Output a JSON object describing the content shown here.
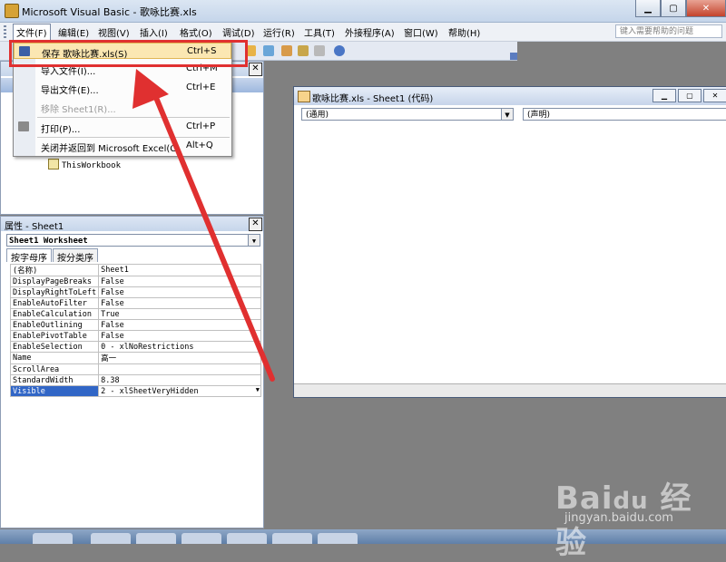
{
  "window": {
    "title": "Microsoft Visual Basic - 歌咏比赛.xls"
  },
  "menubar": {
    "items": [
      "文件(F)",
      "编辑(E)",
      "视图(V)",
      "插入(I)",
      "格式(O)",
      "调试(D)",
      "运行(R)",
      "工具(T)",
      "外接程序(A)",
      "窗口(W)",
      "帮助(H)"
    ],
    "help_placeholder": "键入需要帮助的问题"
  },
  "file_menu": {
    "items": [
      {
        "label": "保存 歌咏比赛.xls(S)",
        "shortcut": "Ctrl+S"
      },
      {
        "label": "导入文件(I)...",
        "shortcut": "Ctrl+M"
      },
      {
        "label": "导出文件(E)...",
        "shortcut": "Ctrl+E"
      },
      {
        "label": "移除 Sheet1(R)...",
        "shortcut": ""
      },
      {
        "label": "打印(P)...",
        "shortcut": "Ctrl+P"
      },
      {
        "label": "关闭并返回到 Microsoft Excel(C)",
        "shortcut": "Alt+Q"
      }
    ]
  },
  "project": {
    "node": "ThisWorkbook"
  },
  "properties": {
    "title": "属性 - Sheet1",
    "object": "Sheet1 Worksheet",
    "tabs": [
      "按字母序",
      "按分类序"
    ],
    "rows": [
      {
        "k": "(名称)",
        "v": "Sheet1"
      },
      {
        "k": "DisplayPageBreaks",
        "v": "False"
      },
      {
        "k": "DisplayRightToLeft",
        "v": "False"
      },
      {
        "k": "EnableAutoFilter",
        "v": "False"
      },
      {
        "k": "EnableCalculation",
        "v": "True"
      },
      {
        "k": "EnableOutlining",
        "v": "False"
      },
      {
        "k": "EnablePivotTable",
        "v": "False"
      },
      {
        "k": "EnableSelection",
        "v": "0 - xlNoRestrictions"
      },
      {
        "k": "Name",
        "v": "高一"
      },
      {
        "k": "ScrollArea",
        "v": ""
      },
      {
        "k": "StandardWidth",
        "v": "8.38"
      },
      {
        "k": "Visible",
        "v": "2 - xlSheetVeryHidden"
      }
    ]
  },
  "code_window": {
    "title": "歌咏比赛.xls - Sheet1 (代码)",
    "object_combo": "(通用)",
    "proc_combo": "(声明)"
  },
  "watermark": {
    "url": "jingyan.baidu.com"
  },
  "colors": {
    "accent": "#3166c6",
    "annotation": "#e03030",
    "highlight": "#fbe7b2"
  }
}
